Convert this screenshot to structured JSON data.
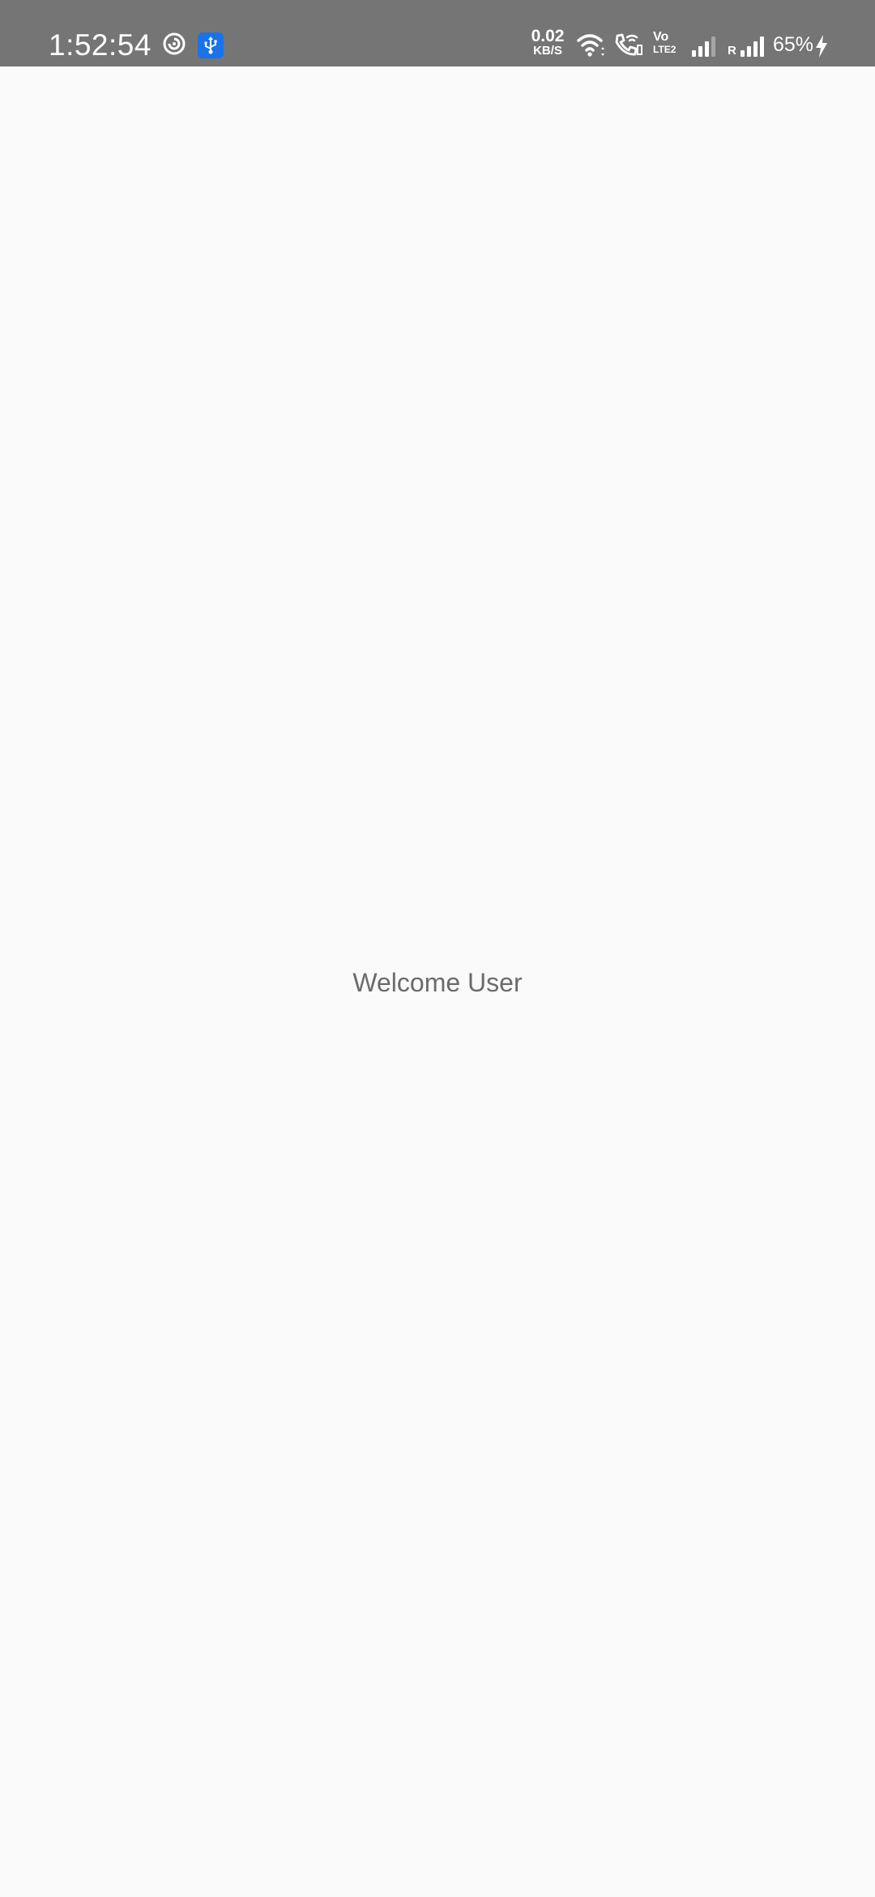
{
  "status_bar": {
    "time": "1:52:54",
    "net_speed_value": "0.02",
    "net_speed_unit": "KB/S",
    "volte_top": "Vo",
    "volte_bottom": "LTE2",
    "roaming_indicator": "R",
    "battery_percent": "65%",
    "icons": [
      "hotspot-swirl-icon",
      "usb-icon",
      "wifi-icon",
      "wifi-calling-icon",
      "volte-icon",
      "signal-sim1-icon",
      "signal-sim2-icon",
      "charging-bolt-icon"
    ],
    "colors": {
      "bar_background": "#757575",
      "usb_badge": "#1a73e8",
      "text": "#ffffff"
    }
  },
  "main": {
    "welcome_text": "Welcome User",
    "background": "#fafafa",
    "text_color": "#6b6b6b"
  }
}
